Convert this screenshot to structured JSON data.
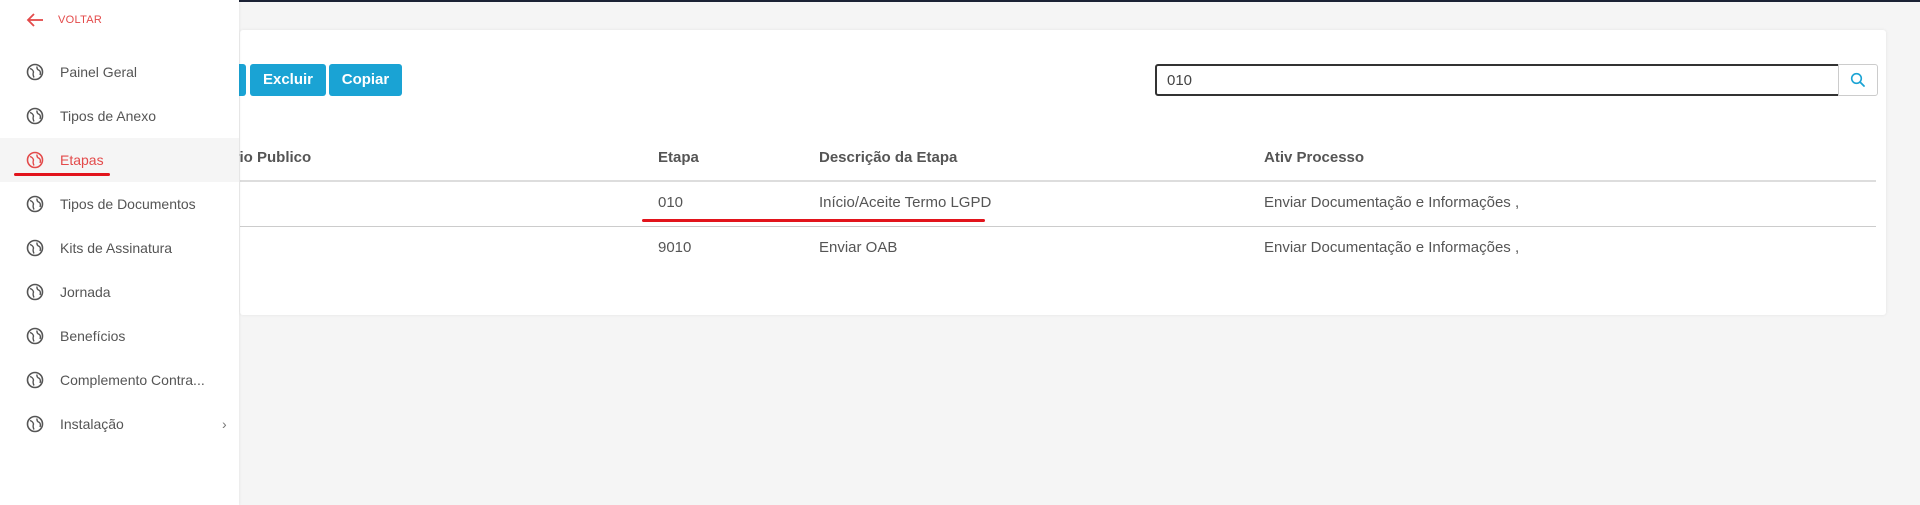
{
  "sidebar": {
    "back_label": "VOLTAR",
    "items": [
      {
        "label": "Painel Geral"
      },
      {
        "label": "Tipos de Anexo"
      },
      {
        "label": "Etapas"
      },
      {
        "label": "Tipos de Documentos"
      },
      {
        "label": "Kits de Assinatura"
      },
      {
        "label": "Jornada"
      },
      {
        "label": "Benefícios"
      },
      {
        "label": "Complemento Contra..."
      },
      {
        "label": "Instalação"
      }
    ]
  },
  "toolbar": {
    "delete_label": "Excluir",
    "copy_label": "Copiar"
  },
  "search": {
    "value": "010"
  },
  "table": {
    "headers": [
      "ulário Publico",
      "Etapa",
      "Descrição da Etapa",
      "Ativ Processo"
    ],
    "rows": [
      {
        "etapa": "010",
        "descricao": "Início/Aceite Termo LGPD",
        "ativ": "Enviar Documentação e Informações ,"
      },
      {
        "etapa": "9010",
        "descricao": "Enviar OAB",
        "ativ": "Enviar Documentação e Informações ,"
      }
    ]
  },
  "colors": {
    "accent": "#1aa3d4",
    "active": "#e34a4a",
    "highlight_underline": "#e2141c"
  }
}
